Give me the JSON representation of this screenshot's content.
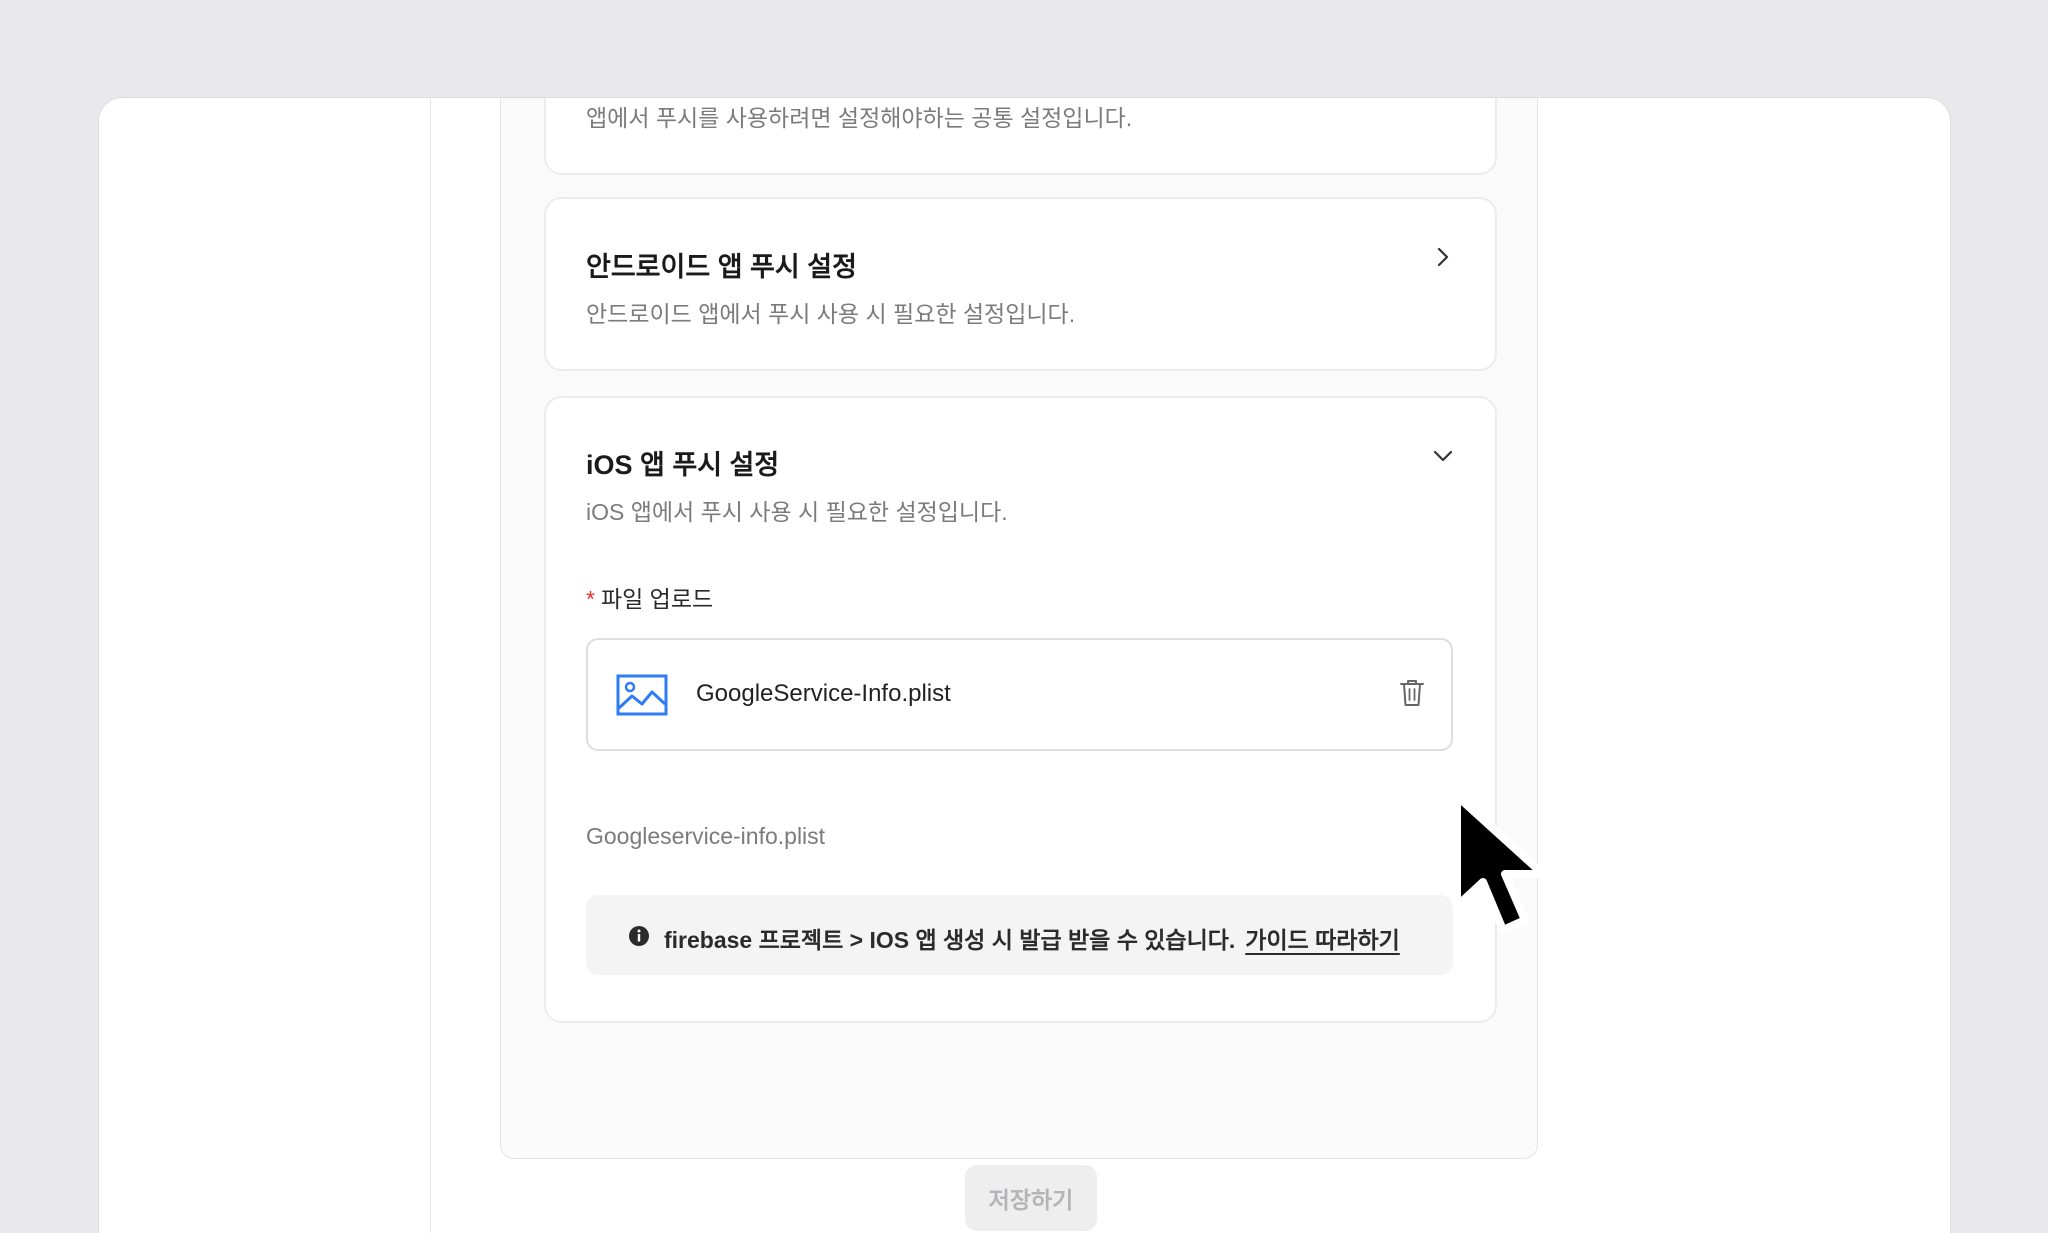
{
  "common_card": {
    "desc": "앱에서 푸시를 사용하려면 설정해야하는 공통 설정입니다."
  },
  "android_card": {
    "title": "안드로이드 앱 푸시 설정",
    "desc": "안드로이드 앱에서 푸시 사용 시 필요한 설정입니다.",
    "chevron": "chevron-right-icon"
  },
  "ios_card": {
    "title": "iOS 앱 푸시 설정",
    "desc": "iOS 앱에서 푸시 사용 시 필요한 설정입니다.",
    "chevron": "chevron-down-icon",
    "upload": {
      "required_mark": "*",
      "label": "파일 업로드",
      "file_name": "GoogleService-Info.plist",
      "file_icon": "image-icon",
      "delete_icon": "trash-icon",
      "helper_text": "Googleservice-info.plist"
    },
    "notice": {
      "icon": "info-icon",
      "text": "firebase 프로젝트 > IOS 앱 생성 시 발급 받을 수 있습니다.",
      "link_label": "가이드 따라하기"
    }
  },
  "actions": {
    "save_label": "저장하기"
  },
  "colors": {
    "background": "#e9e9eb",
    "required": "#e5332a",
    "file_icon": "#2f7cf6",
    "disabled_button_bg": "#eeeeef",
    "disabled_button_text": "#b4b4b6"
  }
}
